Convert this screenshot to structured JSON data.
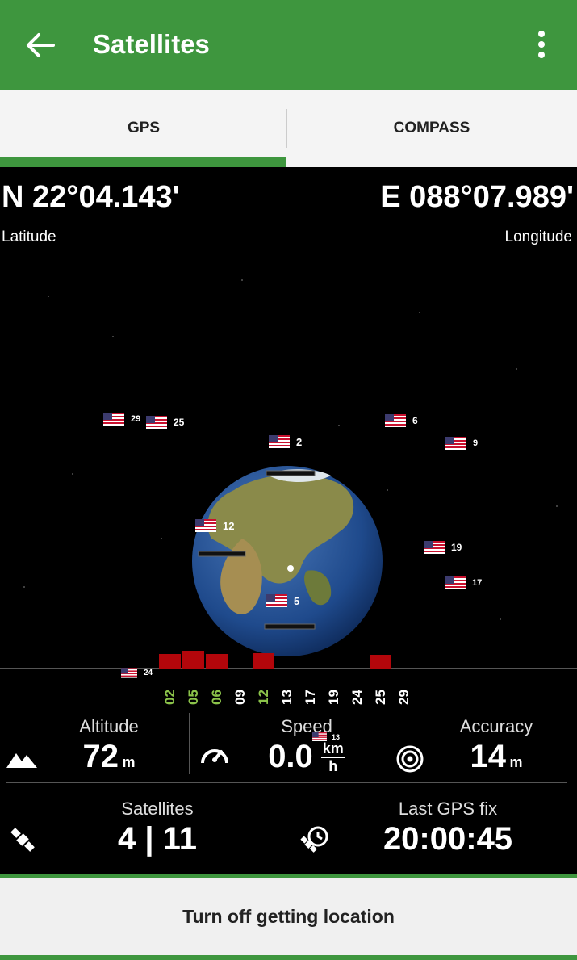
{
  "appbar": {
    "title": "Satellites",
    "back_icon": "arrow-left-icon",
    "menu_icon": "more-vert-icon"
  },
  "tabs": [
    {
      "label": "GPS",
      "selected": true
    },
    {
      "label": "COMPASS",
      "selected": false
    }
  ],
  "colors": {
    "primary": "#3e963e",
    "bar": "#b3060b",
    "prn_used": "#8bc34a",
    "prn_unused": "#ffffff"
  },
  "position": {
    "latitude": "N 22°04.143'",
    "latitude_label": "Latitude",
    "longitude": "E 088°07.989'",
    "longitude_label": "Longitude"
  },
  "satellites": [
    {
      "prn": "29"
    },
    {
      "prn": "25"
    },
    {
      "prn": "2"
    },
    {
      "prn": "6"
    },
    {
      "prn": "9"
    },
    {
      "prn": "12"
    },
    {
      "prn": "19"
    },
    {
      "prn": "17"
    },
    {
      "prn": "5"
    },
    {
      "prn": "24"
    },
    {
      "prn": "13"
    }
  ],
  "signal_bars": [
    {
      "prn": "02",
      "used": true,
      "level": 0.8
    },
    {
      "prn": "05",
      "used": true,
      "level": 1.0
    },
    {
      "prn": "06",
      "used": true,
      "level": 0.8
    },
    {
      "prn": "09",
      "used": false,
      "level": 0
    },
    {
      "prn": "12",
      "used": true,
      "level": 0.85
    },
    {
      "prn": "13",
      "used": false,
      "level": 0
    },
    {
      "prn": "17",
      "used": false,
      "level": 0
    },
    {
      "prn": "19",
      "used": false,
      "level": 0
    },
    {
      "prn": "24",
      "used": false,
      "level": 0
    },
    {
      "prn": "25",
      "used": false,
      "level": 0.75
    },
    {
      "prn": "29",
      "used": false,
      "level": 0
    }
  ],
  "stats": {
    "altitude": {
      "label": "Altitude",
      "value": "72",
      "unit": "m",
      "icon": "mountain-icon"
    },
    "speed": {
      "label": "Speed",
      "value": "0.0",
      "unit_top": "km",
      "unit_bottom": "h",
      "icon": "speedometer-icon"
    },
    "accuracy": {
      "label": "Accuracy",
      "value": "14",
      "unit": "m",
      "icon": "target-icon"
    },
    "satellites": {
      "label": "Satellites",
      "value": "4 | 11",
      "icon": "satellite-icon"
    },
    "last_fix": {
      "label": "Last GPS fix",
      "value": "20:00:45",
      "icon": "satellite-clock-icon"
    }
  },
  "bottom_button": {
    "label": "Turn off getting location"
  }
}
